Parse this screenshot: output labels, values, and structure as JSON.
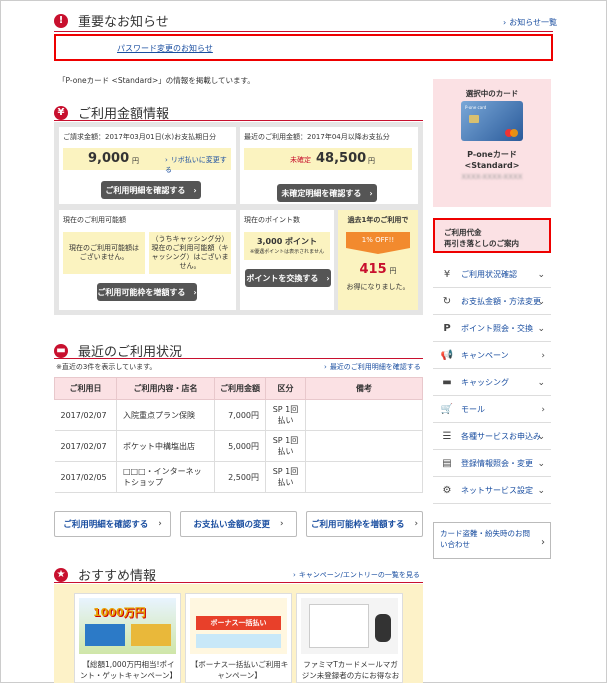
{
  "notice": {
    "title": "重要なお知らせ",
    "list_link": "お知らせ一覧",
    "item_link": "パスワード変更のお知らせ"
  },
  "card_info_text": "「P-oneカード <Standard>」の情報を掲載しています。",
  "usage": {
    "title": "ご利用金額情報",
    "billing_label": "ご請求金額：",
    "billing_date": "2017年03月01日(水)お支払期日分",
    "billing_amount": "9,000",
    "yen": "円",
    "revo_link": "リボ払いに変更する",
    "billing_button": "ご利用明細を確認する",
    "recent_label": "最近のご利用金額：",
    "recent_date": "2017年04月以降お支払分",
    "unconfirmed": "未確定",
    "recent_amount": "48,500",
    "recent_button": "未確定明細を確認する",
    "available_title": "現在のご利用可能額",
    "available_msg": "現在のご利用可能額はございません。",
    "cashing_msg": "（うちキャッシング分）現在のご利用可能額（キャッシング）はございません。",
    "increase_button": "ご利用可能枠を増額する",
    "points_title": "現在のポイント数",
    "points_value": "3,000 ポイント",
    "points_note": "※優遇ポイントは表示されません",
    "points_button": "ポイントを交換する",
    "year_title": "過去1年のご利用で",
    "off_badge": "1% OFF!!",
    "saved_amount": "415",
    "saved_text": "お得になりました。"
  },
  "history": {
    "title": "最近のご利用状況",
    "note": "※直近の3件を表示しています。",
    "link": "最近のご利用明細を確認する",
    "headers": [
      "ご利用日",
      "ご利用内容・店名",
      "ご利用金額",
      "区分",
      "備考"
    ],
    "rows": [
      [
        "2017/02/07",
        "入院重点プラン保険",
        "7,000円",
        "SP 1回払い",
        ""
      ],
      [
        "2017/02/07",
        "ポケット中構塩出店",
        "5,000円",
        "SP 1回払い",
        ""
      ],
      [
        "2017/02/05",
        "□□□・インターネットショップ",
        "2,500円",
        "SP 1回払い",
        ""
      ]
    ]
  },
  "bottom_buttons": [
    "ご利用明細を確認する",
    "お支払い金額の変更",
    "ご利用可能枠を増額する"
  ],
  "recommend": {
    "title": "おすすめ情報",
    "link": "キャンペーン/エントリーの一覧を見る",
    "banners": [
      {
        "img_text": "1000万円",
        "caption": "【総額1,000万円相当!ポイント・ゲットキャンペーン】"
      },
      {
        "img_text": "ボーナス一括払い",
        "caption": "【ボーナス一括払いご利用キャンペーン】"
      },
      {
        "img_text": "",
        "caption": "ファミマTカードメールマガジン未登録者の方にお得なお"
      }
    ]
  },
  "sidebar": {
    "card_title": "選択中のカード",
    "card_name": "P-oneカード",
    "card_type": "<Standard>",
    "card_number": "XXXX-XXXX-XXXX",
    "alert_line1": "ご利用代金",
    "alert_line2": "再引き落としのご案内",
    "menu": [
      {
        "icon": "¥",
        "label": "ご利用状況確認",
        "chev": "⌄"
      },
      {
        "icon": "↻",
        "label": "お支払金額・方法変更",
        "chev": "⌄"
      },
      {
        "icon": "P",
        "label": "ポイント照会・交換",
        "chev": "⌄"
      },
      {
        "icon": "📢",
        "label": "キャンペーン",
        "chev": "›"
      },
      {
        "icon": "▬",
        "label": "キャッシング",
        "chev": "⌄"
      },
      {
        "icon": "🛒",
        "label": "モール",
        "chev": "›"
      },
      {
        "icon": "☰",
        "label": "各種サービスお申込み",
        "chev": "⌄"
      },
      {
        "icon": "▤",
        "label": "登録情報照会・変更",
        "chev": "⌄"
      },
      {
        "icon": "⚙",
        "label": "ネットサービス設定",
        "chev": "⌄"
      }
    ],
    "lost_card": "カード盗難・紛失時のお問い合わせ"
  },
  "colors": {
    "accent": "#c8102e",
    "link": "#1a4ea0",
    "yellow": "#fbf3c0",
    "pink": "#fbe1e4"
  }
}
